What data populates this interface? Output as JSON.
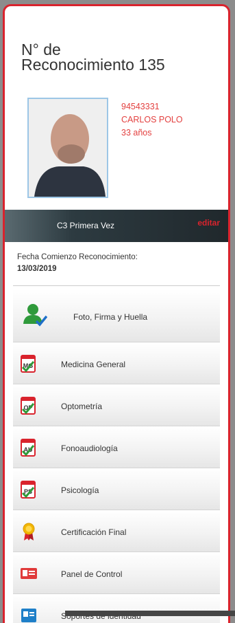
{
  "header": {
    "title_line1": "N° de",
    "title_line2": "Reconocimiento 135"
  },
  "patient": {
    "id": "94543331",
    "name": "CARLOS POLO",
    "age": "33 años"
  },
  "banner": {
    "license": "C3 Primera Vez",
    "edit_label": "editar"
  },
  "start": {
    "label": "Fecha Comienzo Reconocimiento:",
    "date": "13/03/2019"
  },
  "menu": {
    "items": [
      {
        "label": "Foto, Firma y Huella",
        "icon": "user-check-icon"
      },
      {
        "label": "Medicina General",
        "icon": "medicine-doc-icon",
        "code": "MG"
      },
      {
        "label": "Optometría",
        "icon": "optometry-doc-icon",
        "code": "OP"
      },
      {
        "label": "Fonoaudiología",
        "icon": "audiology-doc-icon",
        "code": "AU"
      },
      {
        "label": "Psicología",
        "icon": "psychology-doc-icon",
        "code": "PS"
      },
      {
        "label": "Certificación Final",
        "icon": "award-ribbon-icon"
      },
      {
        "label": "Panel de Control",
        "icon": "id-card-icon"
      },
      {
        "label": "Soportes de identidad",
        "icon": "document-id-icon"
      }
    ]
  },
  "colors": {
    "accent": "#d9232d",
    "info_text": "#e3403f",
    "banner": "#20282c"
  }
}
